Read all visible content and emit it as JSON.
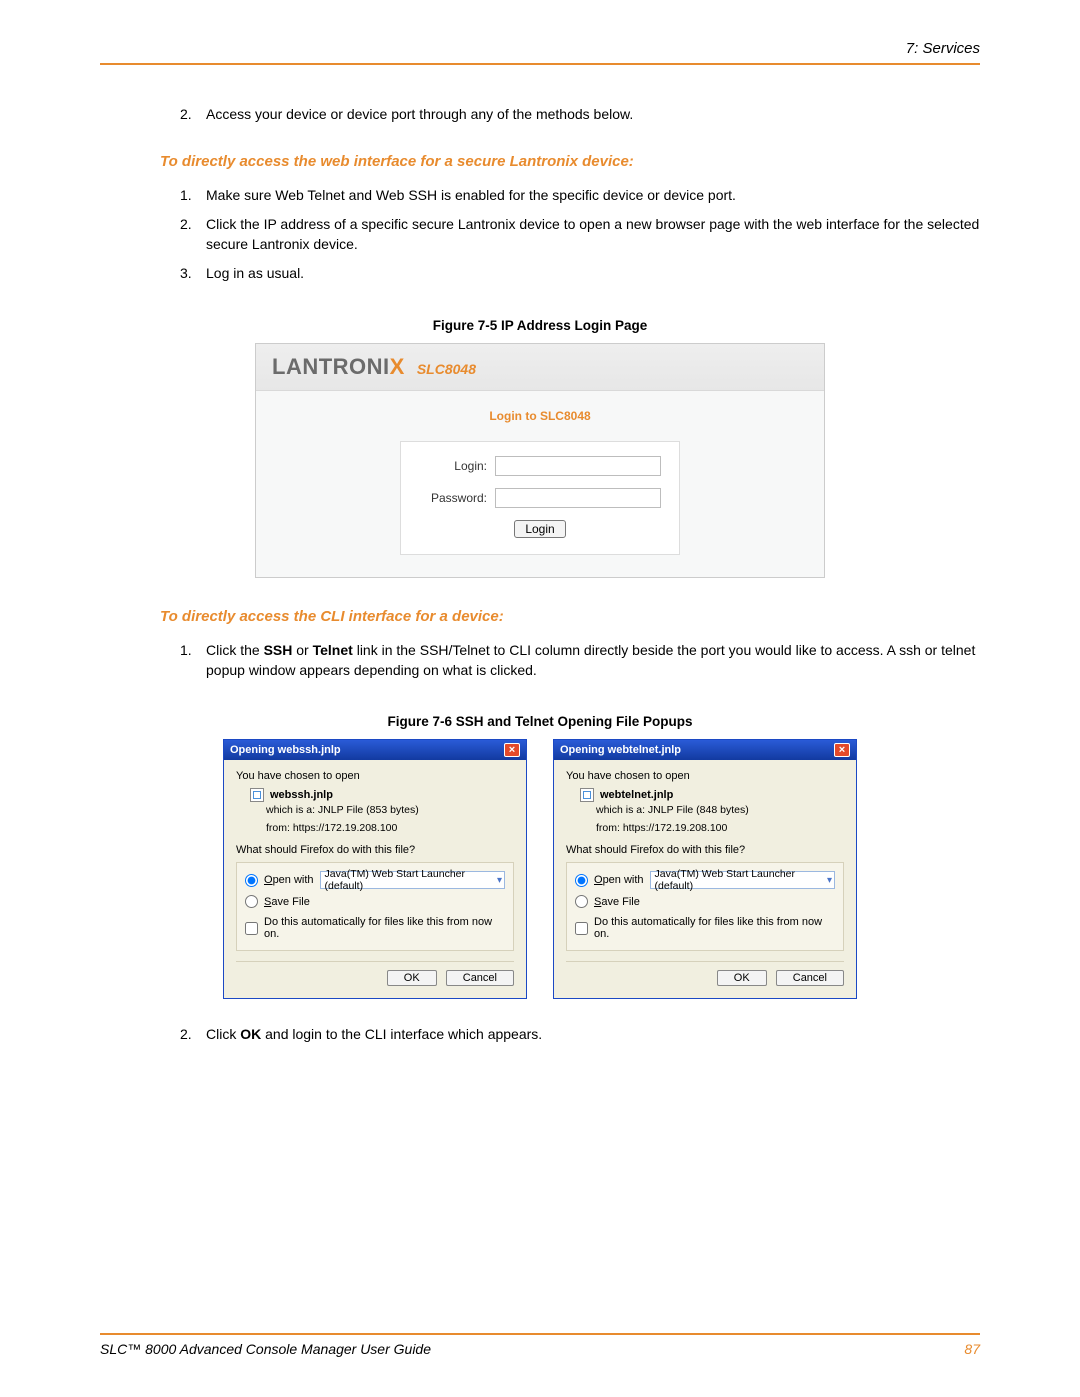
{
  "header": {
    "section": "7: Services"
  },
  "intro_item": {
    "num": "2.",
    "text": "Access your device or device port through any of the methods below."
  },
  "heading_web": "To directly access the web interface for a secure Lantronix device:",
  "web_steps": [
    {
      "num": "1.",
      "text": "Make sure Web Telnet and Web SSH is enabled for the specific device or device port."
    },
    {
      "num": "2.",
      "text": "Click the IP address of a specific secure Lantronix device to open a new browser page with the web interface for the selected secure Lantronix device."
    },
    {
      "num": "3.",
      "text": "Log in as usual."
    }
  ],
  "figure75_caption": "Figure 7-5  IP Address Login Page",
  "login_box": {
    "logo_pre": "LANTRONI",
    "logo_x": "X",
    "model": "SLC8048",
    "title": "Login to SLC8048",
    "login_label": "Login:",
    "password_label": "Password:",
    "button": "Login"
  },
  "heading_cli": "To directly access the CLI interface for a device:",
  "cli_step1": {
    "num": "1.",
    "pre": "Click the ",
    "bold1": "SSH",
    "mid1": " or ",
    "bold2": "Telnet",
    "post": " link in the SSH/Telnet to CLI column directly beside the port you would like to access. A ssh or telnet popup window appears depending on what is clicked."
  },
  "figure76_caption": "Figure 7-6  SSH and Telnet Opening File Popups",
  "popups": [
    {
      "title": "Opening webssh.jnlp",
      "chosen": "You have chosen to open",
      "filename": "webssh.jnlp",
      "meta1": "which is a:  JNLP File (853 bytes)",
      "meta2": "from:  https://172.19.208.100",
      "question": "What should Firefox do with this file?",
      "open_with": "Open with",
      "open_u": "O",
      "launcher": "Java(TM) Web Start Launcher (default)",
      "save_file": "Save File",
      "save_u": "S",
      "auto": "Do this automatically for files like this from now on.",
      "auto_u": "a",
      "ok": "OK",
      "cancel": "Cancel"
    },
    {
      "title": "Opening webtelnet.jnlp",
      "chosen": "You have chosen to open",
      "filename": "webtelnet.jnlp",
      "meta1": "which is a:  JNLP File (848 bytes)",
      "meta2": "from:  https://172.19.208.100",
      "question": "What should Firefox do with this file?",
      "open_with": "Open with",
      "open_u": "O",
      "launcher": "Java(TM) Web Start Launcher (default)",
      "save_file": "Save File",
      "save_u": "S",
      "auto": "Do this automatically for files like this from now on.",
      "auto_u": "a",
      "ok": "OK",
      "cancel": "Cancel"
    }
  ],
  "cli_step2": {
    "num": "2.",
    "pre": "Click ",
    "bold": "OK",
    "post": " and login to the CLI interface which appears."
  },
  "footer": {
    "title": "SLC™ 8000 Advanced Console Manager User Guide",
    "page": "87"
  }
}
